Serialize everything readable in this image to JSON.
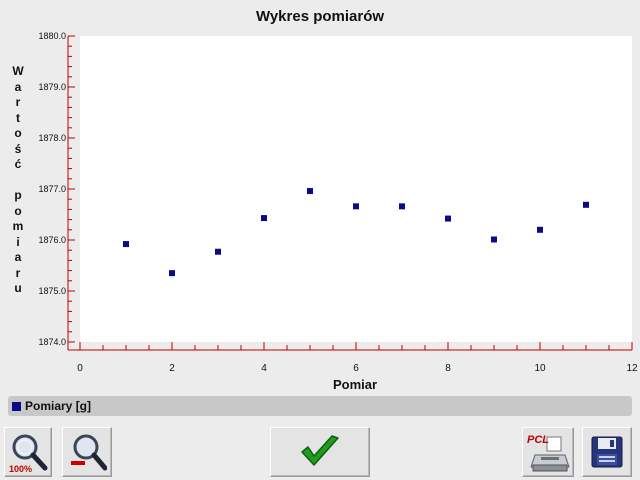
{
  "window": {
    "title": "Wykres pomiarów"
  },
  "chart_data": {
    "type": "scatter",
    "title": "Wykres pomiarów",
    "xlabel": "Pomiar",
    "ylabel": "Wartość pomiaru",
    "xlim": [
      0,
      12
    ],
    "ylim": [
      1874.0,
      1880.0
    ],
    "x_ticks": [
      "0",
      "2",
      "4",
      "6",
      "8",
      "10",
      "12"
    ],
    "y_ticks": [
      "1874.0",
      "1875.0",
      "1876.0",
      "1877.0",
      "1878.0",
      "1879.0",
      "1880.0"
    ],
    "grid": false,
    "legend": "bottom",
    "series": [
      {
        "name": "Pomiary [g]",
        "color": "#0b0b8a",
        "x": [
          1,
          2,
          3,
          4,
          5,
          6,
          7,
          8,
          9,
          10,
          11
        ],
        "y": [
          1875.92,
          1875.35,
          1875.77,
          1876.43,
          1876.96,
          1876.66,
          1876.66,
          1876.42,
          1876.01,
          1876.2,
          1876.69
        ]
      }
    ]
  },
  "toolbar": {
    "zoom_reset_label": "100%",
    "pcl_label": "PCL"
  },
  "icons": {
    "zoom_reset": "magnifier-100-icon",
    "zoom_out": "magnifier-minus-icon",
    "confirm": "green-check-icon",
    "print": "pcl-printer-icon",
    "save": "floppy-disk-icon"
  },
  "colors": {
    "axis": "#c00000",
    "point": "#0b0b8a",
    "check": "#1f9d1f"
  }
}
